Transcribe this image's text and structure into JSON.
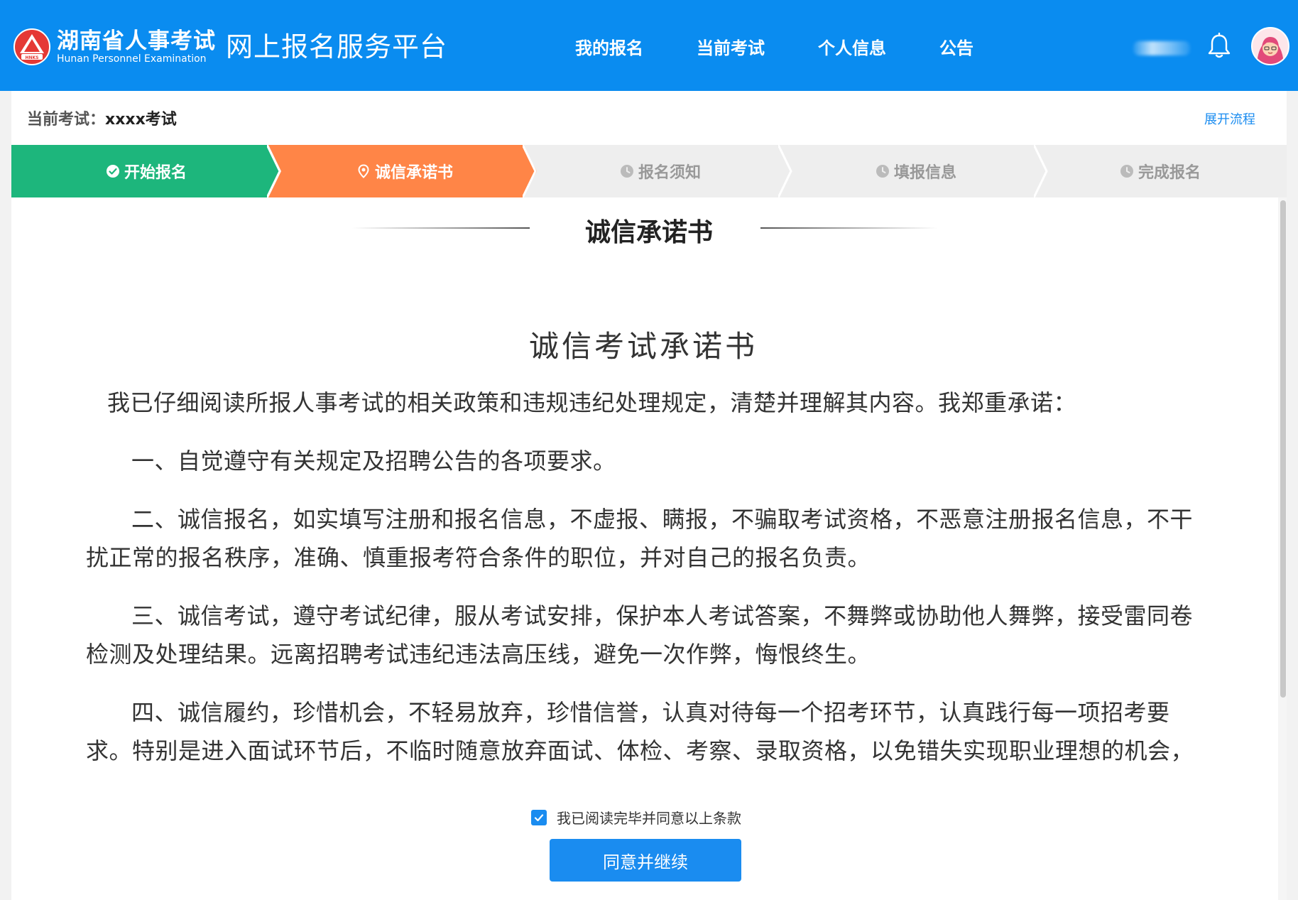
{
  "header": {
    "logo_cn": "湖南省人事考试",
    "logo_en": "Hunan Personnel Examination",
    "logo_badge": "HNKS",
    "platform_name": "网上报名服务平台",
    "nav": [
      "我的报名",
      "当前考试",
      "个人信息",
      "公告"
    ]
  },
  "exam_bar": {
    "label": "当前考试：",
    "exam_name": "xxxx考试",
    "expand_link": "展开流程"
  },
  "steps": [
    {
      "label": "开始报名",
      "state": "done",
      "icon": "check-circle-icon",
      "color": "#1db67c"
    },
    {
      "label": "诚信承诺书",
      "state": "active",
      "icon": "location-pin-icon",
      "color": "#ff8547"
    },
    {
      "label": "报名须知",
      "state": "pending",
      "icon": "clock-icon",
      "color": "#eeeeee"
    },
    {
      "label": "填报信息",
      "state": "pending",
      "icon": "clock-icon",
      "color": "#eeeeee"
    },
    {
      "label": "完成报名",
      "state": "pending",
      "icon": "clock-icon",
      "color": "#eeeeee"
    }
  ],
  "panel": {
    "section_title": "诚信承诺书"
  },
  "document": {
    "title": "诚信考试承诺书",
    "intro": "我已仔细阅读所报人事考试的相关政策和违规违纪处理规定，清楚并理解其内容。我郑重承诺：",
    "clauses": [
      "一、自觉遵守有关规定及招聘公告的各项要求。",
      "二、诚信报名，如实填写注册和报名信息，不虚报、瞒报，不骗取考试资格，不恶意注册报名信息，不干扰正常的报名秩序，准确、慎重报考符合条件的职位，并对自己的报名负责。",
      "三、诚信考试，遵守考试纪律，服从考试安排，保护本人考试答案，不舞弊或协助他人舞弊，接受雷同卷检测及处理结果。远离招聘考试违纪违法高压线，避免一次作弊，悔恨终生。",
      "四、诚信履约，珍惜机会，不轻易放弃，珍惜信誉，认真对待每一个招考环节，认真践行每一项招考要求。特别是进入面试环节后，不临时随意放弃面试、体检、考察、录取资格，以免错失实现职业理想的机会，影响其他"
    ]
  },
  "footer": {
    "agree_text": "我已阅读完毕并同意以上条款",
    "agree_checked": true,
    "continue_button": "同意并继续"
  },
  "colors": {
    "header_bg": "#0a8cf0",
    "primary": "#1a8cf0",
    "done": "#1db67c",
    "active": "#ff8547",
    "pending": "#eeeeee"
  }
}
